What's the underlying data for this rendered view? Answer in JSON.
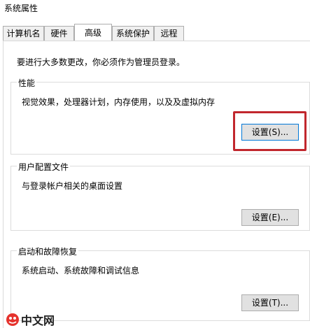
{
  "window": {
    "title": "系统属性"
  },
  "tabs": [
    {
      "label": "计算机名",
      "active": false
    },
    {
      "label": "硬件",
      "active": false
    },
    {
      "label": "高级",
      "active": true
    },
    {
      "label": "系统保护",
      "active": false
    },
    {
      "label": "远程",
      "active": false
    }
  ],
  "advanced": {
    "admin_notice": "要进行大多数更改，你必须作为管理员登录。",
    "performance": {
      "title": "性能",
      "description": "视觉效果，处理器计划，内存使用，以及及虚拟内存",
      "button_label": "设置(S)..."
    },
    "user_profiles": {
      "title": "用户配置文件",
      "description": "与登录帐户相关的桌面设置",
      "button_label": "设置(E)..."
    },
    "startup_recovery": {
      "title": "启动和故障恢复",
      "description": "系统启动、系统故障和调试信息",
      "button_label": "设置(T)..."
    }
  },
  "annotation": {
    "highlight_color": "#c1272d"
  },
  "watermark": {
    "text": "中文网"
  }
}
